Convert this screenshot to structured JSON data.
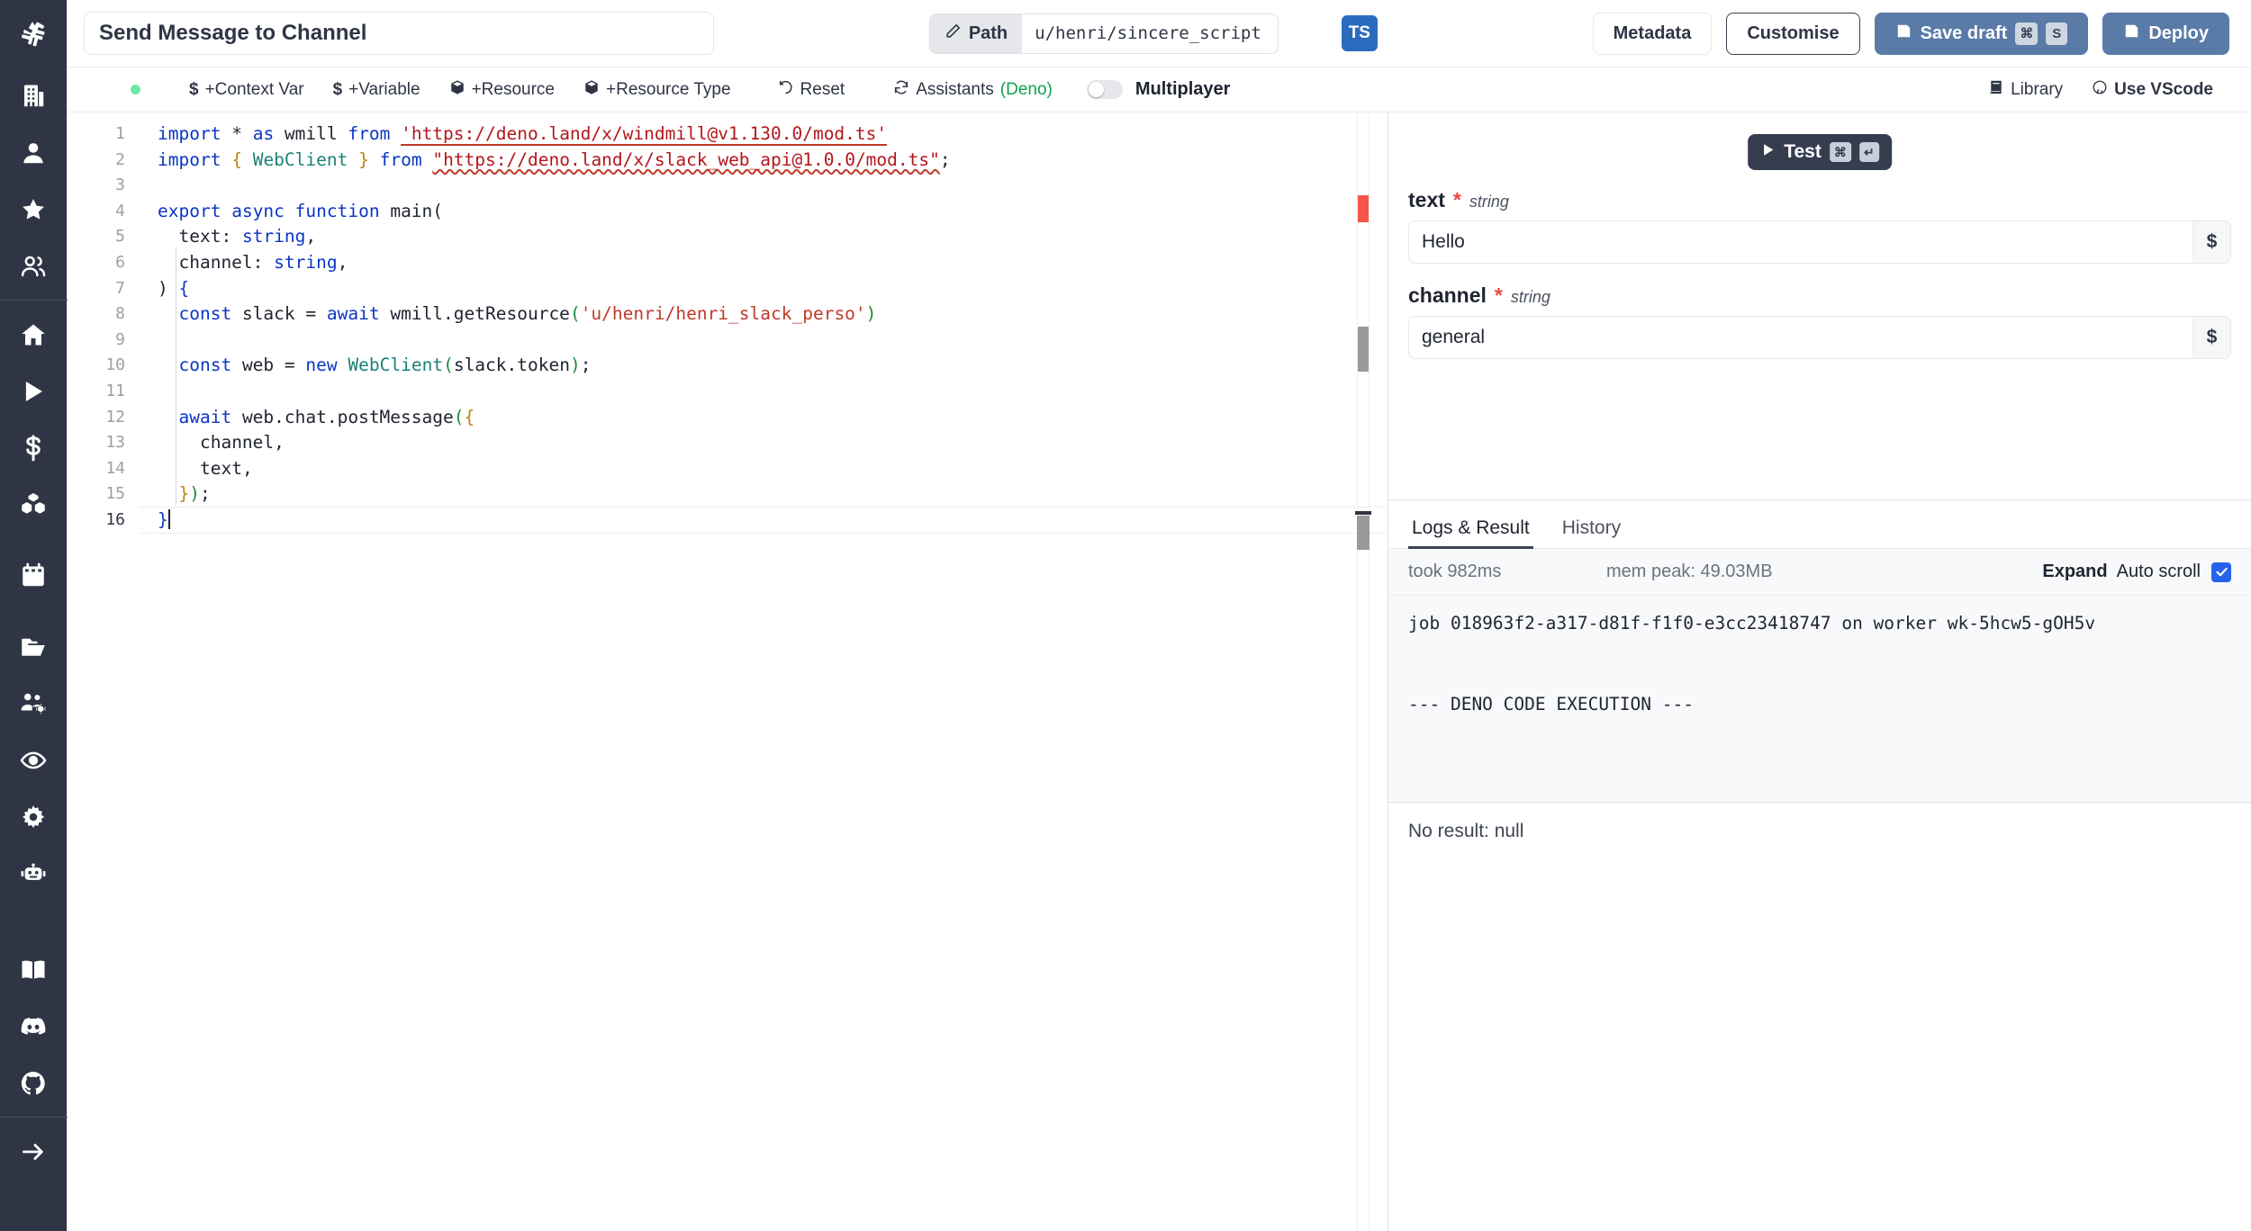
{
  "sidebar": {
    "logo": "windmill-logo-icon",
    "items": [
      {
        "name": "building-icon"
      },
      {
        "name": "user-icon"
      },
      {
        "name": "star-icon"
      },
      {
        "name": "users-icon"
      },
      {
        "name": "home-icon"
      },
      {
        "name": "play-icon"
      },
      {
        "name": "dollar-icon"
      },
      {
        "name": "cubes-icon"
      },
      {
        "name": "calendar-icon"
      },
      {
        "name": "folder-icon"
      },
      {
        "name": "user-settings-icon"
      },
      {
        "name": "eye-icon"
      },
      {
        "name": "gear-icon"
      },
      {
        "name": "robot-icon"
      },
      {
        "name": "book-icon"
      },
      {
        "name": "discord-icon"
      },
      {
        "name": "github-icon"
      },
      {
        "name": "arrow-right-icon"
      }
    ]
  },
  "topbar": {
    "title": "Send Message to Channel",
    "title_placeholder": "Script name",
    "path_label": "Path",
    "path_value": "u/henri/sincere_script",
    "language_badge": "TS",
    "metadata_label": "Metadata",
    "customise_label": "Customise",
    "save_draft_label": "Save draft",
    "save_draft_keys": [
      "⌘",
      "S"
    ],
    "deploy_label": "Deploy"
  },
  "actionbar": {
    "status_color": "#6ee7a8",
    "context_var_label": "+Context Var",
    "variable_label": "+Variable",
    "resource_label": "+Resource",
    "resource_type_label": "+Resource Type",
    "reset_label": "Reset",
    "assistants_label": "Assistants",
    "assistants_lang": "(Deno)",
    "multiplayer_label": "Multiplayer",
    "multiplayer_on": false,
    "library_label": "Library",
    "vscode_label": "Use VScode"
  },
  "editor": {
    "lines": [
      {
        "n": 1,
        "html": "<span class=\"kw\">import</span> <span class=\"punct\">*</span> <span class=\"kw\">as</span> wmill <span class=\"kw\">from</span> <span class=\"str u-solid\">'https://deno.land/x/windmill@v1.130.0/mod.ts'</span>"
      },
      {
        "n": 2,
        "html": "<span class=\"kw\">import</span> <span class=\"brace-y\">{</span> <span class=\"cls\">WebClient</span> <span class=\"brace-y\">}</span> <span class=\"kw\">from</span> <span class=\"str u-wavy\">\"https://deno.land/x/slack_web_api@1.0.0/mod.ts\"</span><span class=\"punct\">;</span>"
      },
      {
        "n": 3,
        "html": ""
      },
      {
        "n": 4,
        "html": "<span class=\"kw\">export</span> <span class=\"kw\">async</span> <span class=\"kw\">function</span> <span class=\"plain\">main</span><span class=\"punct\">(</span>"
      },
      {
        "n": 5,
        "html": "  <span class=\"plain\">text</span><span class=\"punct\">: </span><span class=\"kw2\">string</span><span class=\"punct\">,</span>"
      },
      {
        "n": 6,
        "html": "  <span class=\"plain\">channel</span><span class=\"punct\">: </span><span class=\"kw2\">string</span><span class=\"punct\">,</span>"
      },
      {
        "n": 7,
        "html": "<span class=\"punct\">)</span> <span class=\"brace-b\">{</span>"
      },
      {
        "n": 8,
        "html": "  <span class=\"kw\">const</span> <span class=\"plain\">slack</span> <span class=\"punct\">=</span> <span class=\"kw\">await</span> <span class=\"plain\">wmill.getResource</span><span class=\"brace-g\">(</span><span class=\"strg\">'u/henri/henri_slack_perso'</span><span class=\"brace-g\">)</span>"
      },
      {
        "n": 9,
        "html": ""
      },
      {
        "n": 10,
        "html": "  <span class=\"kw\">const</span> <span class=\"plain\">web</span> <span class=\"punct\">=</span> <span class=\"kw\">new</span> <span class=\"cls\">WebClient</span><span class=\"brace-g\">(</span><span class=\"plain\">slack.token</span><span class=\"brace-g\">)</span><span class=\"punct\">;</span>"
      },
      {
        "n": 11,
        "html": ""
      },
      {
        "n": 12,
        "html": "  <span class=\"kw\">await</span> <span class=\"plain\">web.chat.postMessage</span><span class=\"brace-g\">(</span><span class=\"brace-y\">{</span>"
      },
      {
        "n": 13,
        "html": "    <span class=\"plain\">channel</span><span class=\"punct\">,</span>"
      },
      {
        "n": 14,
        "html": "    <span class=\"plain\">text</span><span class=\"punct\">,</span>"
      },
      {
        "n": 15,
        "html": "  <span class=\"brace-y\">}</span><span class=\"brace-g\">)</span><span class=\"punct\">;</span>"
      },
      {
        "n": 16,
        "html": "<span class=\"brace-b\">}</span><span class=\"caret\"></span>"
      }
    ],
    "current_line": 16
  },
  "test": {
    "label": "Test",
    "keys": [
      "⌘",
      "↵"
    ]
  },
  "args": {
    "fields": [
      {
        "name": "text",
        "required": "*",
        "type": "string",
        "value": "Hello",
        "dollar": "$"
      },
      {
        "name": "channel",
        "required": "*",
        "type": "string",
        "value": "general",
        "dollar": "$"
      }
    ]
  },
  "logs": {
    "tabs": [
      {
        "label": "Logs & Result",
        "active": true
      },
      {
        "label": "History",
        "active": false
      }
    ],
    "took": "took 982ms",
    "mem_peak": "mem peak: 49.03MB",
    "expand_label": "Expand",
    "autoscroll_label": "Auto scroll",
    "autoscroll_checked": true,
    "output_lines": [
      "job 018963f2-a317-d81f-f1f0-e3cc23418747 on worker wk-5hcw5-gOH5v",
      "",
      "",
      "--- DENO CODE EXECUTION ---"
    ],
    "result_text": "No result: null"
  },
  "colors": {
    "rail_bg": "#2f3545",
    "primary": "#5a7ba8",
    "accent_green": "#12a150",
    "error_red": "#f4564a",
    "checkbox_blue": "#2563eb"
  }
}
